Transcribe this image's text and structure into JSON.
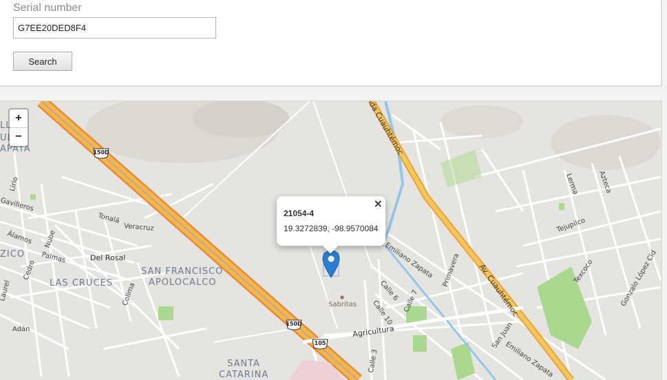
{
  "search_form": {
    "serial_label": "Serial number",
    "serial_value": "G7EE20DED8F4",
    "search_button_label": "Search"
  },
  "map": {
    "zoom_in_label": "+",
    "zoom_out_label": "−",
    "popup": {
      "title": "21054-4",
      "coordinates": "19.3272839, -98.9570084",
      "close_label": "×"
    },
    "highway_shields": [
      "150D",
      "150D",
      "105"
    ],
    "poi": "Sabritas",
    "district_labels": [
      "LLÓN",
      "ULLO",
      "APATA",
      "ZICO",
      "LAS CRUCES",
      "SAN FRANCISCO",
      "APOLOCALCO",
      "SANTA",
      "CATARINA"
    ],
    "street_labels": {
      "lirio": "Lirio",
      "gavilleros": "Gavilleros",
      "alamos": "Álamos",
      "nube": "Nube",
      "tonala": "Tonalá",
      "veracruz": "Veracruz",
      "palmas": "Palmas",
      "cedro": "Cedro",
      "del_rosal": "Del Rosal",
      "laurel": "Laurel",
      "colima": "Colima",
      "adan": "Adán",
      "avenida_cuauhtemoc_top": "Avenida Cuauhtémoc",
      "av_cuauhtemoc": "Av. Cuauhtémoc",
      "emiliano_zapata": "Emiliano Zapata",
      "emiliano_zapata_2": "Emiliano Zapata",
      "primavera": "Primavera",
      "calle_6": "Calle 6",
      "calle_7": "Calle 7",
      "calle_10": "Calle 10",
      "calle_3": "Calle 3",
      "agricultura": "Agricultura",
      "san_juan": "San Juan",
      "lerma": "Lerma",
      "azteca": "Azteca",
      "tejupilco": "Tejupilco",
      "texcoco": "Texcoco",
      "gonzalo_lopez_cid": "Gonzalo López Cid"
    },
    "colors": {
      "highway": "#f0b547",
      "highway_edge": "#e89a3c",
      "water": "#8fc8ea",
      "park": "#a9d88e",
      "marker": "#2a7fd4",
      "land": "#e6e4e0"
    }
  }
}
